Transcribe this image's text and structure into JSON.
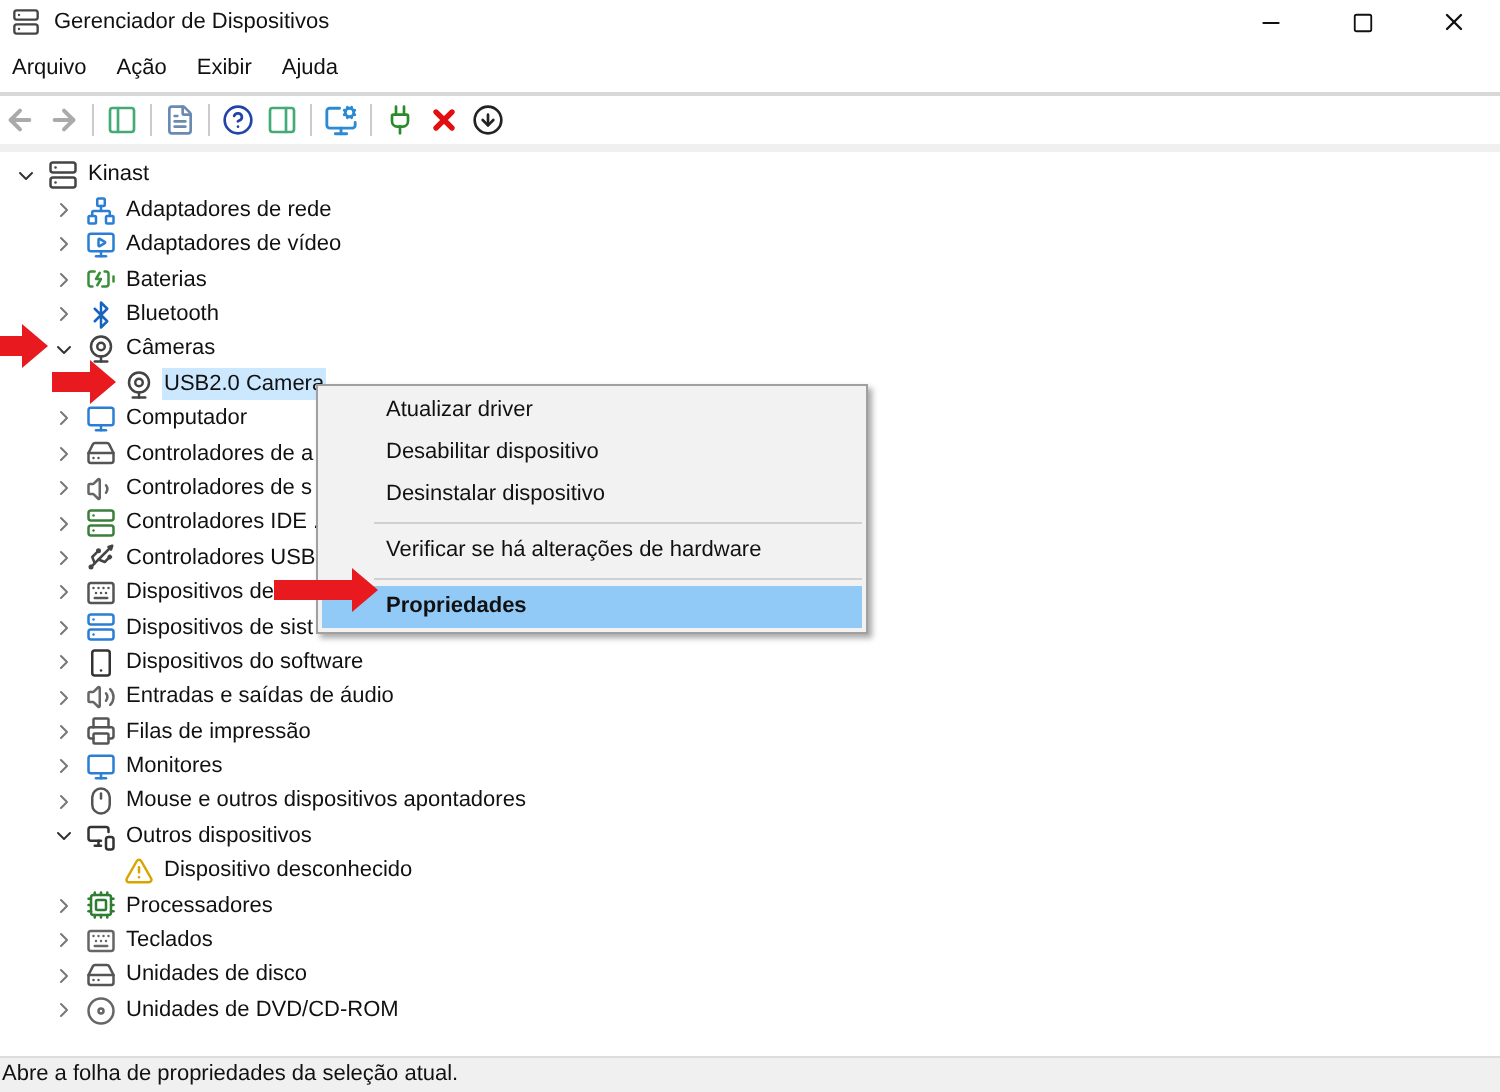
{
  "window": {
    "title": "Gerenciador de Dispositivos"
  },
  "menu_bar": [
    "Arquivo",
    "Ação",
    "Exibir",
    "Ajuda"
  ],
  "tree": {
    "label": "Kinast",
    "expanded": true,
    "selected": false,
    "children": [
      {
        "label": "Adaptadores de rede",
        "expanded": false,
        "selected": false
      },
      {
        "label": "Adaptadores de vídeo",
        "expanded": false,
        "selected": false
      },
      {
        "label": "Baterias",
        "expanded": false,
        "selected": false
      },
      {
        "label": "Bluetooth",
        "expanded": false,
        "selected": false
      },
      {
        "label": "Câmeras",
        "expanded": true,
        "selected": false,
        "children": [
          {
            "label": "USB2.0 Camera",
            "selected": true,
            "warning": false
          }
        ]
      },
      {
        "label": "Computador",
        "expanded": false,
        "selected": false
      },
      {
        "label": "Controladores de a",
        "expanded": false,
        "selected": false
      },
      {
        "label": "Controladores de s",
        "expanded": false,
        "selected": false
      },
      {
        "label": "Controladores IDE .",
        "expanded": false,
        "selected": false
      },
      {
        "label": "Controladores USB",
        "expanded": false,
        "selected": false
      },
      {
        "label": "Dispositivos de",
        "expanded": false,
        "selected": false
      },
      {
        "label": "Dispositivos de sist",
        "expanded": false,
        "selected": false
      },
      {
        "label": "Dispositivos do software",
        "expanded": false,
        "selected": false
      },
      {
        "label": "Entradas e saídas de áudio",
        "expanded": false,
        "selected": false
      },
      {
        "label": "Filas de impressão",
        "expanded": false,
        "selected": false
      },
      {
        "label": "Monitores",
        "expanded": false,
        "selected": false
      },
      {
        "label": "Mouse e outros dispositivos apontadores",
        "expanded": false,
        "selected": false
      },
      {
        "label": "Outros dispositivos",
        "expanded": true,
        "selected": false,
        "children": [
          {
            "label": "Dispositivo desconhecido",
            "selected": false,
            "warning": true
          }
        ]
      },
      {
        "label": "Processadores",
        "expanded": false,
        "selected": false
      },
      {
        "label": "Teclados",
        "expanded": false,
        "selected": false
      },
      {
        "label": "Unidades de disco",
        "expanded": false,
        "selected": false
      },
      {
        "label": "Unidades de DVD/CD-ROM",
        "expanded": false,
        "selected": false
      }
    ]
  },
  "context_menu": [
    [
      {
        "label": "Atualizar driver",
        "selected": false
      },
      {
        "label": "Desabilitar dispositivo",
        "selected": false
      },
      {
        "label": "Desinstalar dispositivo",
        "selected": false
      }
    ],
    [
      {
        "label": "Verificar se há alterações de hardware",
        "selected": false
      }
    ],
    [
      {
        "label": "Propriedades",
        "selected": true
      }
    ]
  ],
  "status_bar": "Abre a folha de propriedades da seleção atual."
}
